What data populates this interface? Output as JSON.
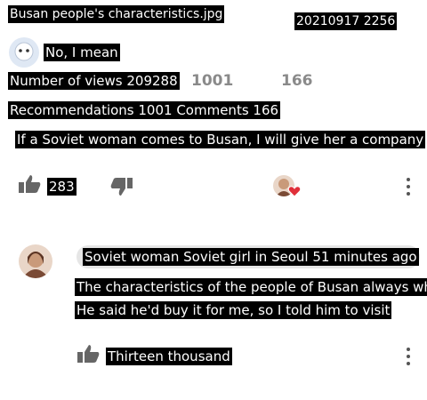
{
  "post": {
    "title": "Busan people's characteristics.jpg",
    "timestamp": "20210917 2256",
    "author": "No, I mean",
    "views": "Number of views 209288",
    "recommend_count": "1001",
    "comment_count": "166",
    "stats": "Recommendations 1001 Comments 166",
    "body_text": "If a Soviet woman comes to Busan, I will give her a company",
    "likes": "283"
  },
  "comment": {
    "author_meta": "Soviet woman Soviet girl in Seoul 51 minutes ago",
    "line1": "The characteristics of the people of Busan always wh",
    "line2": "He said he'd buy it for me, so I told him to visit",
    "likes": "Thirteen thousand"
  },
  "colors": {
    "heart": "#e0303a",
    "avatar_bg": "#e9d6c8"
  }
}
